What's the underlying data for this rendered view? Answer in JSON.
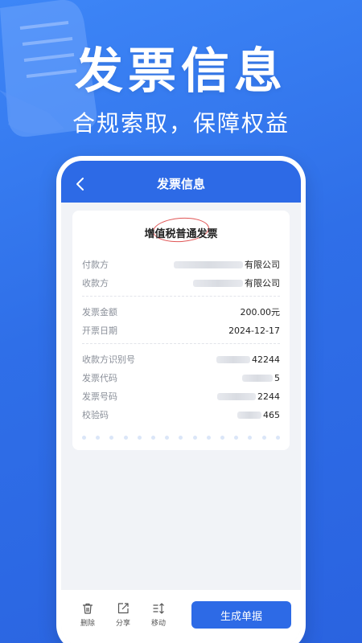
{
  "hero": {
    "title": "发票信息",
    "subtitle": "合规索取，保障权益"
  },
  "navbar": {
    "title": "发票信息",
    "back_icon": "chevron-left-icon"
  },
  "invoice": {
    "title": "增值税普通发票",
    "payer": {
      "label": "付款方",
      "value": "有限公司"
    },
    "payee": {
      "label": "收款方",
      "value": "有限公司"
    },
    "amount": {
      "label": "发票金额",
      "value": "200.00元"
    },
    "date": {
      "label": "开票日期",
      "value": "2024-12-17"
    },
    "payee_tax_id": {
      "label": "收款方识别号",
      "value": "42244"
    },
    "invoice_code": {
      "label": "发票代码",
      "value": "5"
    },
    "invoice_number": {
      "label": "发票号码",
      "value": "2244"
    },
    "check_code": {
      "label": "校验码",
      "value": "465"
    }
  },
  "toolbar": {
    "delete_label": "删除",
    "share_label": "分享",
    "move_label": "移动",
    "generate_label": "生成单据"
  },
  "colors": {
    "background": "#3d86f7",
    "accent": "#2d6ae6",
    "stamp": "#e05555"
  }
}
